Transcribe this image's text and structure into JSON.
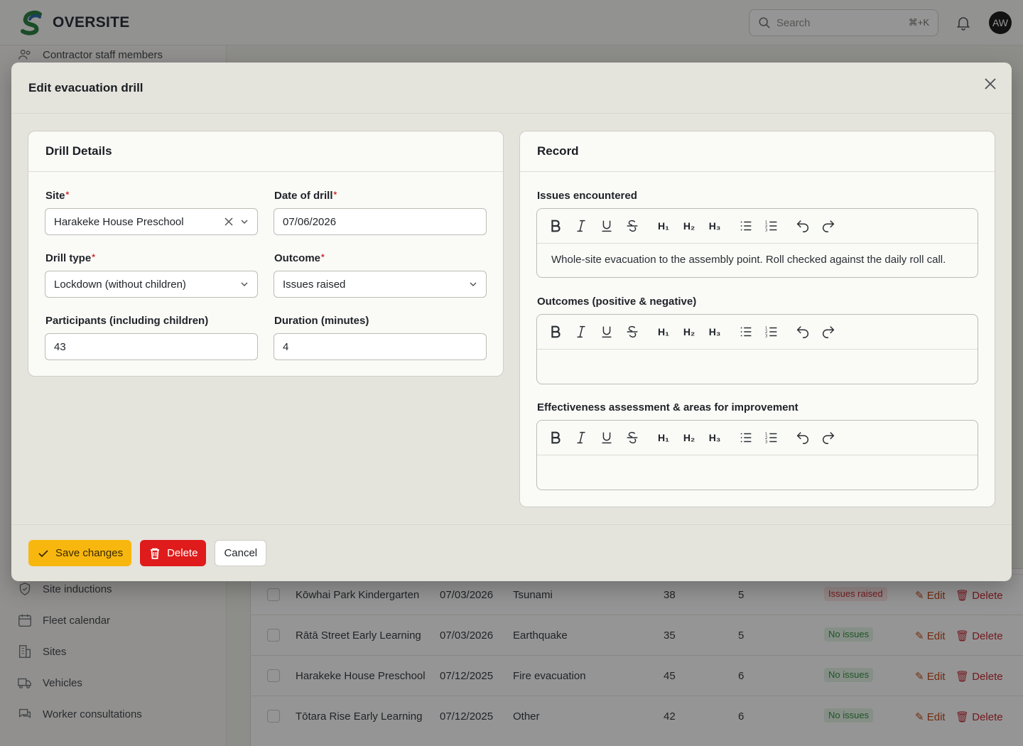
{
  "app": {
    "brand": "OVERSITE",
    "search_placeholder": "Search",
    "search_shortcut": "⌘+K",
    "avatar_initials": "AW"
  },
  "sidebar": {
    "items": [
      {
        "label": "Contractor staff members",
        "icon": "users-icon"
      },
      {
        "label": "Site inductions",
        "icon": "shield-check-icon"
      },
      {
        "label": "Fleet calendar",
        "icon": "calendar-icon"
      },
      {
        "label": "Sites",
        "icon": "building-icon"
      },
      {
        "label": "Vehicles",
        "icon": "truck-icon"
      },
      {
        "label": "Worker consultations",
        "icon": "chat-icon"
      }
    ]
  },
  "table": {
    "edit_label": "Edit",
    "delete_label": "Delete",
    "rows": [
      {
        "site": "Kōwhai Park Kindergarten",
        "date": "07/03/2026",
        "type": "Tsunami",
        "participants": "38",
        "duration": "5",
        "outcome": "Issues raised",
        "status": "issue"
      },
      {
        "site": "Rātā Street Early Learning",
        "date": "07/03/2026",
        "type": "Earthquake",
        "participants": "35",
        "duration": "5",
        "outcome": "No issues",
        "status": "ok"
      },
      {
        "site": "Harakeke House Preschool",
        "date": "07/12/2025",
        "type": "Fire evacuation",
        "participants": "45",
        "duration": "6",
        "outcome": "No issues",
        "status": "ok"
      },
      {
        "site": "Tōtara Rise Early Learning",
        "date": "07/12/2025",
        "type": "Other",
        "participants": "42",
        "duration": "6",
        "outcome": "No issues",
        "status": "ok"
      }
    ]
  },
  "modal": {
    "title": "Edit evacuation drill",
    "details": {
      "heading": "Drill Details",
      "site_label": "Site",
      "site_value": "Harakeke House Preschool",
      "date_label": "Date of drill",
      "date_value": "07/06/2026",
      "type_label": "Drill type",
      "type_value": "Lockdown (without children)",
      "outcome_label": "Outcome",
      "outcome_value": "Issues raised",
      "participants_label": "Participants (including children)",
      "participants_value": "43",
      "duration_label": "Duration (minutes)",
      "duration_value": "4"
    },
    "record": {
      "heading": "Record",
      "issues_label": "Issues encountered",
      "issues_text": "Whole-site evacuation to the assembly point. Roll checked against the daily roll call.",
      "outcomes_label": "Outcomes (positive & negative)",
      "outcomes_text": "",
      "effectiveness_label": "Effectiveness assessment & areas for improvement",
      "effectiveness_text": ""
    },
    "footer": {
      "save_label": "Save changes",
      "delete_label": "Delete",
      "cancel_label": "Cancel"
    }
  },
  "colors": {
    "accent": "#f8b70e",
    "danger": "#df1b1b",
    "required": "#d12b2b"
  }
}
